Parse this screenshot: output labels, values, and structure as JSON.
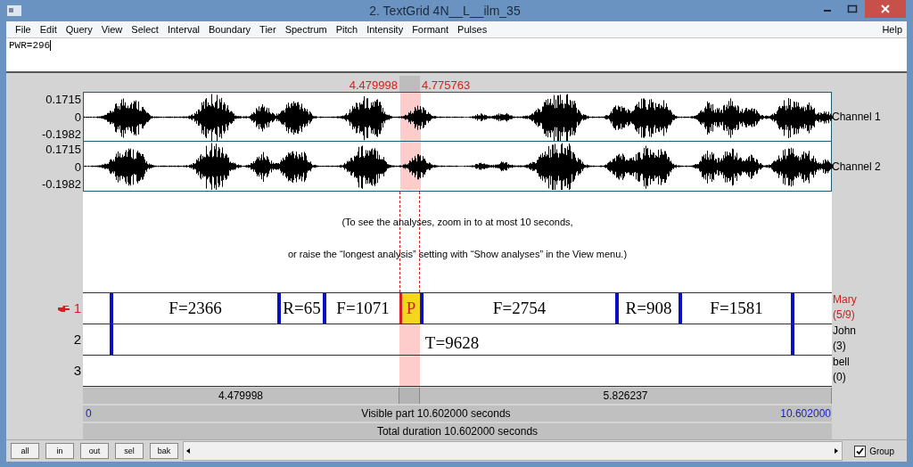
{
  "window": {
    "title": "2. TextGrid 4N__L__ilm_35"
  },
  "menu": [
    "File",
    "Edit",
    "Query",
    "View",
    "Select",
    "Interval",
    "Boundary",
    "Tier",
    "Spectrum",
    "Pitch",
    "Intensity",
    "Formant",
    "Pulses"
  ],
  "help_menu": "Help",
  "script_field": {
    "value": "PWR=296"
  },
  "selection": {
    "start": "4.479998",
    "end": "4.775763"
  },
  "channels": [
    {
      "name": "Channel 1",
      "max": "0.1715",
      "zero": "0",
      "min": "-0.1982"
    },
    {
      "name": "Channel 2",
      "max": "0.1715",
      "zero": "0",
      "min": "-0.1982"
    }
  ],
  "analysis_message": [
    "(To see the analyses, zoom in to at most 10 seconds,",
    "or raise the “longest analysis” setting with “Show analyses” in the View menu.)"
  ],
  "tiers": [
    {
      "number": "1",
      "selected": true,
      "name": "Mary",
      "count": "(5/9)",
      "intervals": [
        {
          "selected": false
        },
        {
          "text": "F=2366",
          "selected": false
        },
        {
          "text": "R=65",
          "selected": false
        },
        {
          "text": "F=1071",
          "selected": false
        },
        {
          "text": "P",
          "selected": true
        },
        {
          "text": "F=2754",
          "selected": false
        },
        {
          "text": "R=908",
          "selected": false
        },
        {
          "text": "F=1581",
          "selected": false
        },
        {
          "selected": false
        }
      ]
    },
    {
      "number": "2",
      "selected": false,
      "name": "John",
      "count": "(3)",
      "intervals": [
        {
          "selected": false
        },
        {
          "text": "T=9628",
          "selected": false
        },
        {
          "selected": false
        }
      ]
    },
    {
      "number": "3",
      "selected": false,
      "name": "bell",
      "count": "(0)",
      "intervals": [
        {
          "selected": false
        }
      ]
    }
  ],
  "durations": [
    {
      "label": "4.479998",
      "selected": false
    },
    {
      "selected": true
    },
    {
      "label": "5.826237",
      "selected": false
    }
  ],
  "visible": {
    "start": "0",
    "label": "Visible part 10.602000 seconds",
    "end": "10.602000"
  },
  "total": "Total duration 10.602000 seconds",
  "buttons": [
    "all",
    "in",
    "out",
    "sel",
    "bak"
  ],
  "group": {
    "label": "Group",
    "checked": true
  }
}
